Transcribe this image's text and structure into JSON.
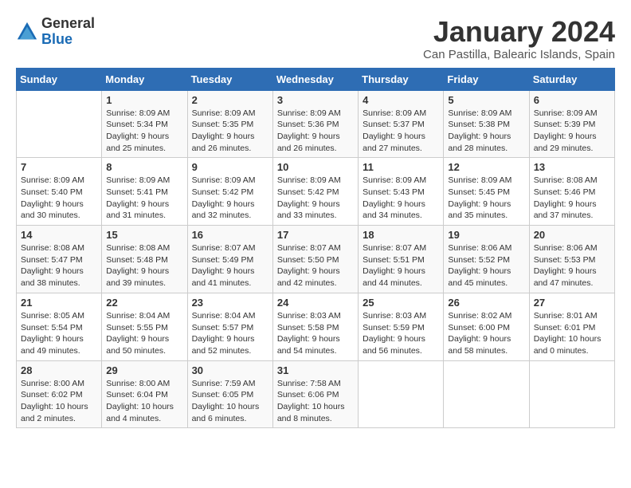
{
  "logo": {
    "general": "General",
    "blue": "Blue"
  },
  "header": {
    "title": "January 2024",
    "subtitle": "Can Pastilla, Balearic Islands, Spain"
  },
  "weekdays": [
    "Sunday",
    "Monday",
    "Tuesday",
    "Wednesday",
    "Thursday",
    "Friday",
    "Saturday"
  ],
  "weeks": [
    [
      {
        "day": "",
        "info": ""
      },
      {
        "day": "1",
        "info": "Sunrise: 8:09 AM\nSunset: 5:34 PM\nDaylight: 9 hours\nand 25 minutes."
      },
      {
        "day": "2",
        "info": "Sunrise: 8:09 AM\nSunset: 5:35 PM\nDaylight: 9 hours\nand 26 minutes."
      },
      {
        "day": "3",
        "info": "Sunrise: 8:09 AM\nSunset: 5:36 PM\nDaylight: 9 hours\nand 26 minutes."
      },
      {
        "day": "4",
        "info": "Sunrise: 8:09 AM\nSunset: 5:37 PM\nDaylight: 9 hours\nand 27 minutes."
      },
      {
        "day": "5",
        "info": "Sunrise: 8:09 AM\nSunset: 5:38 PM\nDaylight: 9 hours\nand 28 minutes."
      },
      {
        "day": "6",
        "info": "Sunrise: 8:09 AM\nSunset: 5:39 PM\nDaylight: 9 hours\nand 29 minutes."
      }
    ],
    [
      {
        "day": "7",
        "info": "Sunrise: 8:09 AM\nSunset: 5:40 PM\nDaylight: 9 hours\nand 30 minutes."
      },
      {
        "day": "8",
        "info": "Sunrise: 8:09 AM\nSunset: 5:41 PM\nDaylight: 9 hours\nand 31 minutes."
      },
      {
        "day": "9",
        "info": "Sunrise: 8:09 AM\nSunset: 5:42 PM\nDaylight: 9 hours\nand 32 minutes."
      },
      {
        "day": "10",
        "info": "Sunrise: 8:09 AM\nSunset: 5:42 PM\nDaylight: 9 hours\nand 33 minutes."
      },
      {
        "day": "11",
        "info": "Sunrise: 8:09 AM\nSunset: 5:43 PM\nDaylight: 9 hours\nand 34 minutes."
      },
      {
        "day": "12",
        "info": "Sunrise: 8:09 AM\nSunset: 5:45 PM\nDaylight: 9 hours\nand 35 minutes."
      },
      {
        "day": "13",
        "info": "Sunrise: 8:08 AM\nSunset: 5:46 PM\nDaylight: 9 hours\nand 37 minutes."
      }
    ],
    [
      {
        "day": "14",
        "info": "Sunrise: 8:08 AM\nSunset: 5:47 PM\nDaylight: 9 hours\nand 38 minutes."
      },
      {
        "day": "15",
        "info": "Sunrise: 8:08 AM\nSunset: 5:48 PM\nDaylight: 9 hours\nand 39 minutes."
      },
      {
        "day": "16",
        "info": "Sunrise: 8:07 AM\nSunset: 5:49 PM\nDaylight: 9 hours\nand 41 minutes."
      },
      {
        "day": "17",
        "info": "Sunrise: 8:07 AM\nSunset: 5:50 PM\nDaylight: 9 hours\nand 42 minutes."
      },
      {
        "day": "18",
        "info": "Sunrise: 8:07 AM\nSunset: 5:51 PM\nDaylight: 9 hours\nand 44 minutes."
      },
      {
        "day": "19",
        "info": "Sunrise: 8:06 AM\nSunset: 5:52 PM\nDaylight: 9 hours\nand 45 minutes."
      },
      {
        "day": "20",
        "info": "Sunrise: 8:06 AM\nSunset: 5:53 PM\nDaylight: 9 hours\nand 47 minutes."
      }
    ],
    [
      {
        "day": "21",
        "info": "Sunrise: 8:05 AM\nSunset: 5:54 PM\nDaylight: 9 hours\nand 49 minutes."
      },
      {
        "day": "22",
        "info": "Sunrise: 8:04 AM\nSunset: 5:55 PM\nDaylight: 9 hours\nand 50 minutes."
      },
      {
        "day": "23",
        "info": "Sunrise: 8:04 AM\nSunset: 5:57 PM\nDaylight: 9 hours\nand 52 minutes."
      },
      {
        "day": "24",
        "info": "Sunrise: 8:03 AM\nSunset: 5:58 PM\nDaylight: 9 hours\nand 54 minutes."
      },
      {
        "day": "25",
        "info": "Sunrise: 8:03 AM\nSunset: 5:59 PM\nDaylight: 9 hours\nand 56 minutes."
      },
      {
        "day": "26",
        "info": "Sunrise: 8:02 AM\nSunset: 6:00 PM\nDaylight: 9 hours\nand 58 minutes."
      },
      {
        "day": "27",
        "info": "Sunrise: 8:01 AM\nSunset: 6:01 PM\nDaylight: 10 hours\nand 0 minutes."
      }
    ],
    [
      {
        "day": "28",
        "info": "Sunrise: 8:00 AM\nSunset: 6:02 PM\nDaylight: 10 hours\nand 2 minutes."
      },
      {
        "day": "29",
        "info": "Sunrise: 8:00 AM\nSunset: 6:04 PM\nDaylight: 10 hours\nand 4 minutes."
      },
      {
        "day": "30",
        "info": "Sunrise: 7:59 AM\nSunset: 6:05 PM\nDaylight: 10 hours\nand 6 minutes."
      },
      {
        "day": "31",
        "info": "Sunrise: 7:58 AM\nSunset: 6:06 PM\nDaylight: 10 hours\nand 8 minutes."
      },
      {
        "day": "",
        "info": ""
      },
      {
        "day": "",
        "info": ""
      },
      {
        "day": "",
        "info": ""
      }
    ]
  ]
}
